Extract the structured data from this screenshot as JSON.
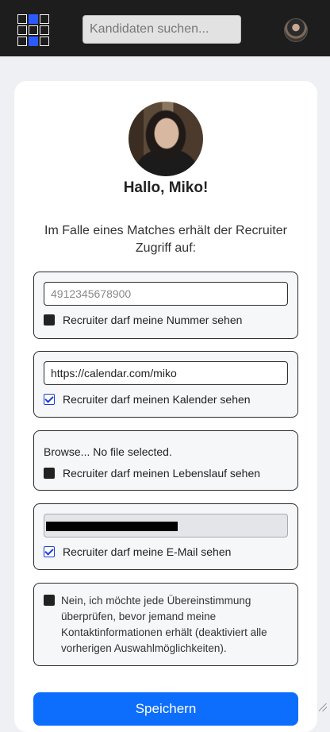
{
  "header": {
    "logo_icon": "grid-logo-icon",
    "search": {
      "placeholder": "Kandidaten suchen...",
      "value": ""
    },
    "profile_icon": "user-avatar-icon"
  },
  "profile": {
    "greeting": "Hallo, Miko!",
    "intro": "Im Falle eines Matches erhält der Recruiter Zugriff auf:"
  },
  "phone": {
    "placeholder": "4912345678900",
    "value": "",
    "label": "Recruiter darf meine Nummer sehen",
    "checked": false
  },
  "calendar": {
    "value": "https://calendar.com/miko",
    "label": "Recruiter darf meinen Kalender sehen",
    "checked": true
  },
  "cv": {
    "file_status": "Browse... No file selected.",
    "label": "Recruiter darf meinen Lebenslauf sehen",
    "checked": false
  },
  "email": {
    "value": "[redacted]",
    "label": "Recruiter darf meine E-Mail sehen",
    "checked": true
  },
  "optout": {
    "label": "Nein, ich möchte jede Übereinstimmung überprüfen, bevor jemand meine Kontaktinformationen erhält (deaktiviert alle vorherigen Auswahlmöglichkeiten).",
    "checked": false
  },
  "actions": {
    "save_label": "Speichern"
  },
  "colors": {
    "accent": "#0d6efd",
    "checkbox_checked": "#1a3dd8",
    "topbar": "#1d1d1d"
  }
}
